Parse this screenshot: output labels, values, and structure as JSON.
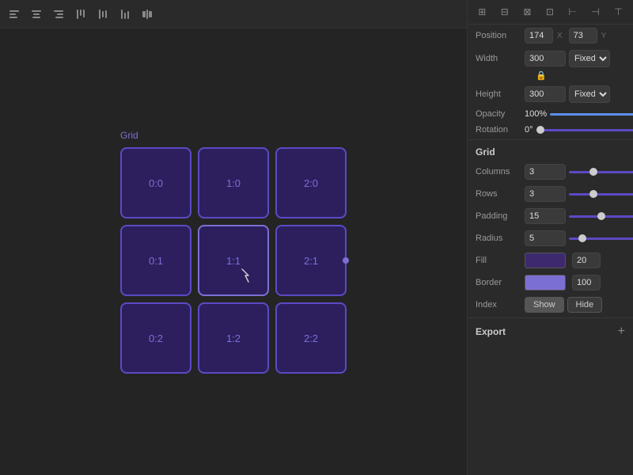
{
  "toolbar": {
    "icons": [
      "⊞",
      "⊟",
      "⊠",
      "⊡",
      "⊢",
      "⊣",
      "⊤"
    ]
  },
  "grid": {
    "label": "Grid",
    "cells": [
      {
        "id": "0:0",
        "col": 0,
        "row": 0
      },
      {
        "id": "1:0",
        "col": 1,
        "row": 0
      },
      {
        "id": "2:0",
        "col": 2,
        "row": 0
      },
      {
        "id": "0:1",
        "col": 0,
        "row": 1
      },
      {
        "id": "1:1",
        "col": 1,
        "row": 1
      },
      {
        "id": "2:1",
        "col": 2,
        "row": 1
      },
      {
        "id": "0:2",
        "col": 0,
        "row": 2
      },
      {
        "id": "1:2",
        "col": 1,
        "row": 2
      },
      {
        "id": "2:2",
        "col": 2,
        "row": 2
      }
    ]
  },
  "panel": {
    "position": {
      "label": "Position",
      "x_value": "174",
      "x_label": "X",
      "y_value": "73",
      "y_label": "Y"
    },
    "width": {
      "label": "Width",
      "value": "300",
      "mode": "Fixed"
    },
    "height": {
      "label": "Height",
      "value": "300",
      "mode": "Fixed"
    },
    "opacity": {
      "label": "Opacity",
      "value": "100%"
    },
    "rotation": {
      "label": "Rotation",
      "value": "0°"
    },
    "grid_section": {
      "label": "Grid"
    },
    "columns": {
      "label": "Columns",
      "value": "3"
    },
    "rows": {
      "label": "Rows",
      "value": "3"
    },
    "padding": {
      "label": "Padding",
      "value": "15"
    },
    "radius": {
      "label": "Radius",
      "value": "5"
    },
    "fill": {
      "label": "Fill",
      "opacity": "20"
    },
    "border": {
      "label": "Border",
      "opacity": "100"
    },
    "index": {
      "label": "Index",
      "show": "Show",
      "hide": "Hide"
    },
    "export": {
      "label": "Export",
      "plus": "+"
    }
  }
}
